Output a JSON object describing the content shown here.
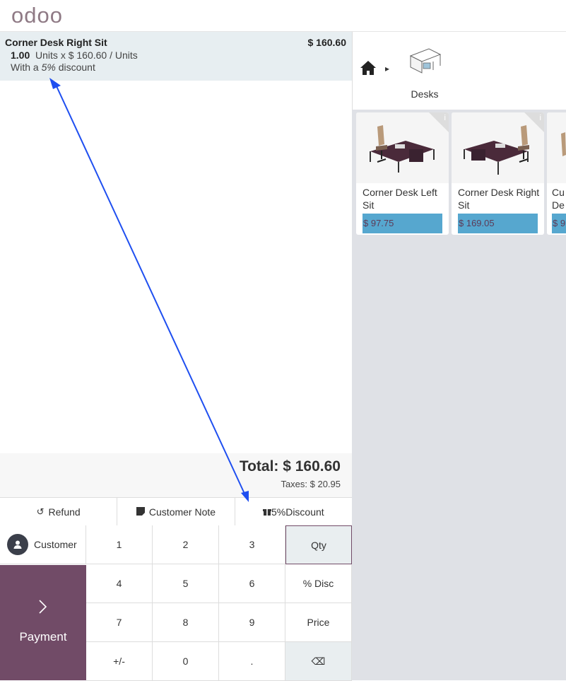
{
  "app": {
    "logo": "odoo"
  },
  "order": {
    "line": {
      "name": "Corner Desk Right Sit",
      "price": "$ 160.60",
      "qty": "1.00",
      "qty_detail": "Units x $ 160.60 / Units",
      "discount_prefix": "With a",
      "discount_value": "5%",
      "discount_suffix": "discount"
    },
    "total": "Total: $ 160.60",
    "taxes": "Taxes: $ 20.95"
  },
  "controls": {
    "refund": "Refund",
    "customer_note": "Customer Note",
    "discount": "5%Discount"
  },
  "customer_label": "Customer",
  "payment_label": "Payment",
  "numpad": {
    "keys": [
      "1",
      "2",
      "3",
      "Qty",
      "4",
      "5",
      "6",
      "% Disc",
      "7",
      "8",
      "9",
      "Price",
      "+/-",
      "0",
      "."
    ],
    "backspace": "⌫",
    "active_mode": "Qty"
  },
  "category": {
    "label": "Desks"
  },
  "products": [
    {
      "name": "Corner Desk Left Sit",
      "price": "$ 97.75"
    },
    {
      "name": "Corner Desk Right Sit",
      "price": "$ 169.05"
    },
    {
      "name": "Cu De",
      "price": "$ 9"
    }
  ],
  "colors": {
    "brand": "#714b67",
    "price_tag": "#56a7cf",
    "arrow": "#1f4ff0"
  }
}
